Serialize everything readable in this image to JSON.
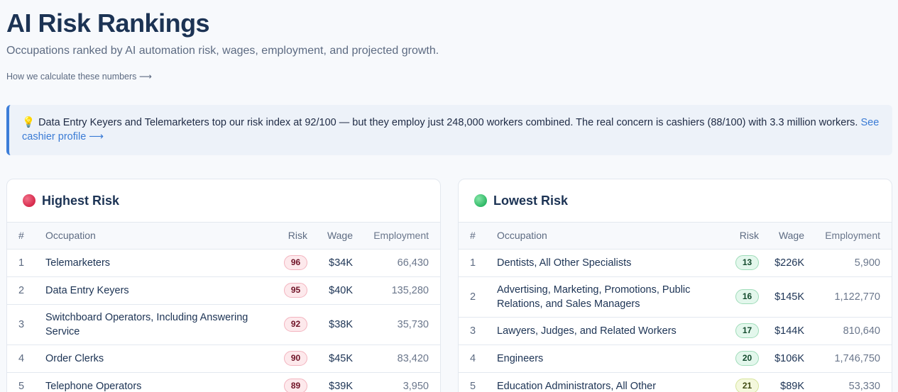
{
  "header": {
    "title": "AI Risk Rankings",
    "subtitle": "Occupations ranked by AI automation risk, wages, employment, and projected growth.",
    "how_link": "How we calculate these numbers ⟶"
  },
  "callout": {
    "icon": "lightbulb-icon",
    "text": "Data Entry Keyers and Telemarketers top our risk index at 92/100 — but they employ just 248,000 workers combined. The real concern is cashiers (88/100) with 3.3 million workers.",
    "link": "See cashier profile ⟶"
  },
  "columns": {
    "rank": "#",
    "occupation": "Occupation",
    "risk": "Risk",
    "wage": "Wage",
    "employment": "Employment"
  },
  "highest": {
    "title": "Highest Risk",
    "dot_color": "#d6294b",
    "rows": [
      {
        "rank": "1",
        "occupation": "Telemarketers",
        "risk": "96",
        "wage": "$34K",
        "employment": "66,430"
      },
      {
        "rank": "2",
        "occupation": "Data Entry Keyers",
        "risk": "95",
        "wage": "$40K",
        "employment": "135,280"
      },
      {
        "rank": "3",
        "occupation": "Switchboard Operators, Including Answering Service",
        "risk": "92",
        "wage": "$38K",
        "employment": "35,730"
      },
      {
        "rank": "4",
        "occupation": "Order Clerks",
        "risk": "90",
        "wage": "$45K",
        "employment": "83,420"
      },
      {
        "rank": "5",
        "occupation": "Telephone Operators",
        "risk": "89",
        "wage": "$39K",
        "employment": "3,950"
      }
    ]
  },
  "lowest": {
    "title": "Lowest Risk",
    "dot_color": "#2fb866",
    "rows": [
      {
        "rank": "1",
        "occupation": "Dentists, All Other Specialists",
        "risk": "13",
        "wage": "$226K",
        "employment": "5,900"
      },
      {
        "rank": "2",
        "occupation": "Advertising, Marketing, Promotions, Public Relations, and Sales Managers",
        "risk": "16",
        "wage": "$145K",
        "employment": "1,122,770"
      },
      {
        "rank": "3",
        "occupation": "Lawyers, Judges, and Related Workers",
        "risk": "17",
        "wage": "$144K",
        "employment": "810,640"
      },
      {
        "rank": "4",
        "occupation": "Engineers",
        "risk": "20",
        "wage": "$106K",
        "employment": "1,746,750"
      },
      {
        "rank": "5",
        "occupation": "Education Administrators, All Other",
        "risk": "21",
        "wage": "$89K",
        "employment": "53,330"
      }
    ]
  }
}
